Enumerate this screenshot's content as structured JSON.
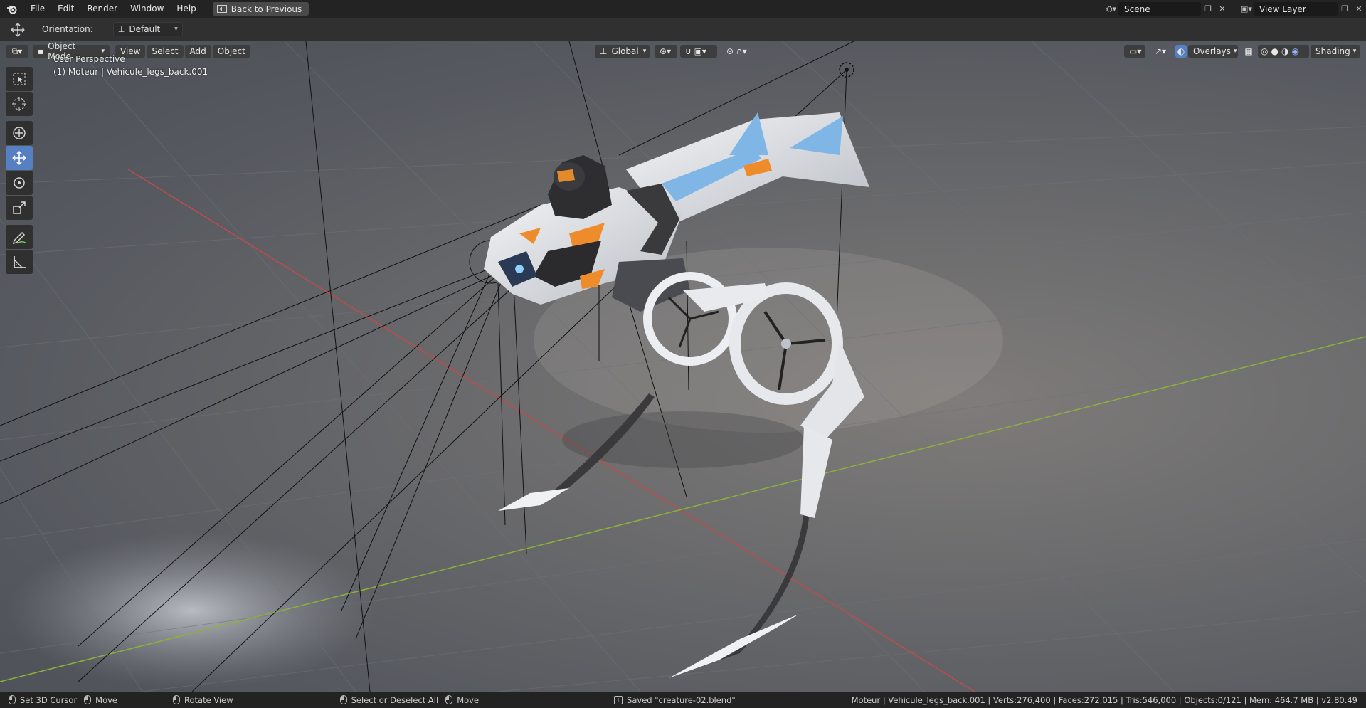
{
  "menu": {
    "items": [
      "File",
      "Edit",
      "Render",
      "Window",
      "Help"
    ],
    "back_button": "Back to Previous"
  },
  "topbar_right": {
    "scene": "Scene",
    "view_layer": "View Layer"
  },
  "tool_header": {
    "orientation_label": "Orientation:",
    "orientation_value": "Default"
  },
  "viewport_header": {
    "mode": "Object Mode",
    "menus": [
      "View",
      "Select",
      "Add",
      "Object"
    ],
    "transform": "Global",
    "overlays": "Overlays",
    "shading": "Shading"
  },
  "viewport": {
    "perspective": "User Perspective",
    "active_object": "(1) Moteur | Vehicule_legs_back.001"
  },
  "status": {
    "items": [
      "Set 3D Cursor",
      "Move",
      "Rotate View",
      "Select or Deselect All",
      "Move"
    ],
    "saved": "Saved \"creature-02.blend\"",
    "stats": "Moteur | Vehicule_legs_back.001 | Verts:276,400 | Faces:272,015 | Tris:546,000 | Objects:0/121 | Mem: 464.7 MB | v2.80.49"
  },
  "colors": {
    "accent": "#5680c2",
    "x_axis": "#c24a4a",
    "y_axis": "#8bb13b"
  }
}
